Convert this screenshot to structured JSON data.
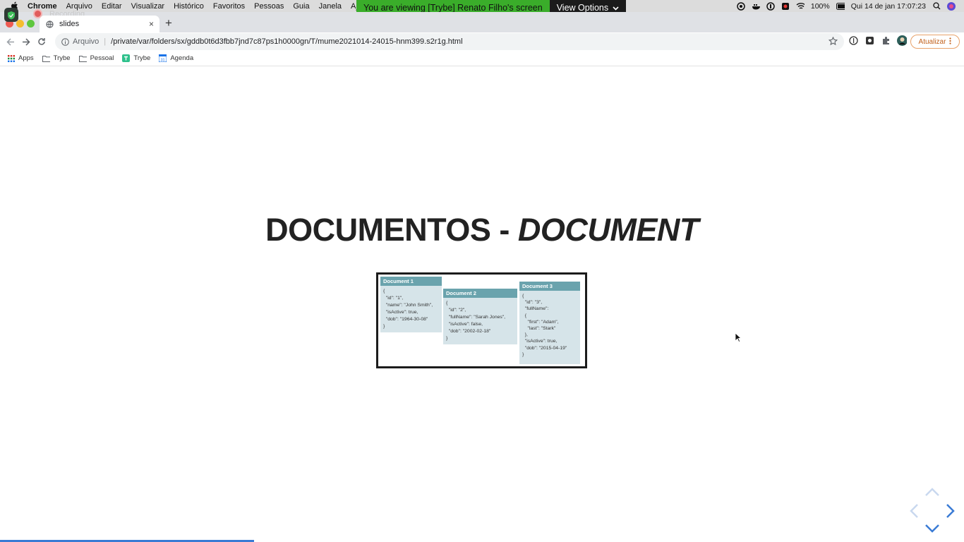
{
  "menubar": {
    "app_name": "Chrome",
    "menus": [
      "Arquivo",
      "Editar",
      "Visualizar",
      "Histórico",
      "Favoritos",
      "Pessoas",
      "Guia",
      "Janela",
      "Ajuda"
    ],
    "share_banner_text": "You are viewing [Trybe] Renato Filho's screen",
    "view_options_label": "View Options",
    "battery": "100%",
    "datetime": "Qui 14 de jan  17:07:23"
  },
  "recording_label": "Recording",
  "tab": {
    "title": "slides",
    "close": "×"
  },
  "toolbar": {
    "scheme_label": "Arquivo",
    "url": "/private/var/folders/sx/gddb0t6d3fbb7jnd7c87ps1h0000gn/T/mume2021014-24015-hnm399.s2r1g.html",
    "update_label": "Atualizar"
  },
  "bookmarks": [
    {
      "label": "Apps",
      "icon": "apps-grid-icon"
    },
    {
      "label": "Trybe",
      "icon": "folder-icon"
    },
    {
      "label": "Pessoal",
      "icon": "folder-icon"
    },
    {
      "label": "Trybe",
      "icon": "trybe-icon"
    },
    {
      "label": "Agenda",
      "icon": "calendar-icon"
    }
  ],
  "slide": {
    "title_main": "DOCUMENTOS - ",
    "title_italic": "DOCUMENT",
    "documents": [
      {
        "header": "Document 1",
        "body": "{\n  \"id\": \"1\",\n  \"name\": \"John Smith\",\n  \"isActive\": true,\n  \"dob\": \"1964-30-08\"\n}"
      },
      {
        "header": "Document 2",
        "body": "{\n  \"id\": \"2\",\n  \"fullName\": \"Sarah Jones\",\n  \"isActive\": false,\n  \"dob\": \"2002-02-18\"\n}"
      },
      {
        "header": "Document 3",
        "body": "{\n  \"id\": \"3\",\n  \"fullName\":\n  {\n    \"first\": \"Adam\",\n    \"last\": \"Stark\"\n  },\n  \"isActive\": true,\n  \"dob\": \"2015-04-19\"\n}"
      }
    ]
  },
  "colors": {
    "share_green": "#3aad2a",
    "doc_header": "#6aa3ad",
    "doc_body": "#d6e4e9",
    "nav_blue": "#3a7bd5"
  }
}
